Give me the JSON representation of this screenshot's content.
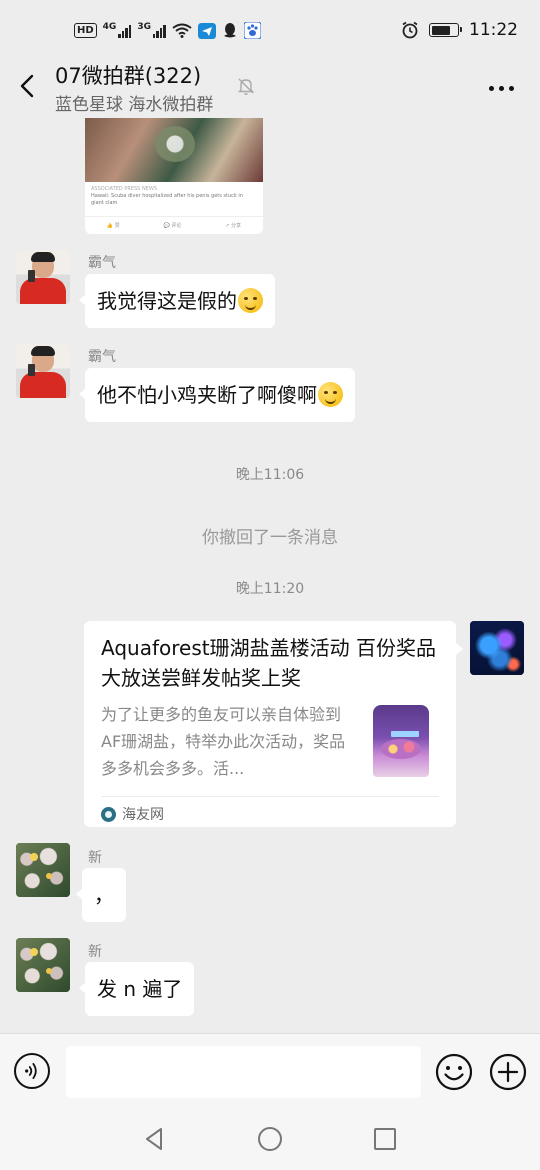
{
  "status_bar": {
    "hd_label": "HD",
    "sim1_label": "4G",
    "sim2_label": "3G",
    "wifi_icon": "wifi-icon",
    "app_icons": [
      "telegram-icon",
      "qq-icon",
      "baidu-icon"
    ],
    "alarm_icon": "alarm-icon",
    "battery_level": 0.75,
    "time": "11:22"
  },
  "header": {
    "title": "07微拍群(322)",
    "subtitle": "蓝色星球 海水微拍群",
    "back_icon": "back-arrow-icon",
    "mute_icon": "mute-bell-icon",
    "more_icon": "more-dots-icon"
  },
  "messages": [
    {
      "type": "image",
      "caption": "Hawaii: Scuba diver hospitalized after his penis gets stuck in giant clam"
    },
    {
      "type": "text",
      "sender": "霸气",
      "avatar": "avatar-red-shirt",
      "text": "我觉得这是假的",
      "emoji": "laughing-tears-emoji"
    },
    {
      "type": "text",
      "sender": "霸气",
      "avatar": "avatar-red-shirt",
      "text": "他不怕小鸡夹断了啊傻啊",
      "emoji": "thinking-emoji"
    },
    {
      "type": "time",
      "text": "晚上11:06"
    },
    {
      "type": "system",
      "text": "你撤回了一条消息"
    },
    {
      "type": "time",
      "text": "晚上11:20"
    },
    {
      "type": "link_card",
      "avatar": "avatar-blue-coral",
      "title": "Aquaforest珊湖盐盖楼活动 百份奖品大放送尝鲜发帖奖上奖",
      "description": "为了让更多的鱼友可以亲自体验到AF珊湖盐，特举办此次活动，奖品多多机会多多。活...",
      "thumbnail": "reef-salt-bag",
      "source": "海友网"
    },
    {
      "type": "text",
      "sender": "新",
      "avatar": "avatar-flowers",
      "text": "，"
    },
    {
      "type": "text",
      "sender": "新",
      "avatar": "avatar-flowers",
      "text": "发 n 遍了"
    }
  ],
  "input_bar": {
    "voice_icon": "voice-icon",
    "placeholder": "",
    "emoji_icon": "emoji-icon",
    "plus_icon": "plus-icon"
  },
  "nav_bar": {
    "back_icon": "nav-back-icon",
    "home_icon": "nav-home-icon",
    "recent_icon": "nav-recent-icon"
  }
}
